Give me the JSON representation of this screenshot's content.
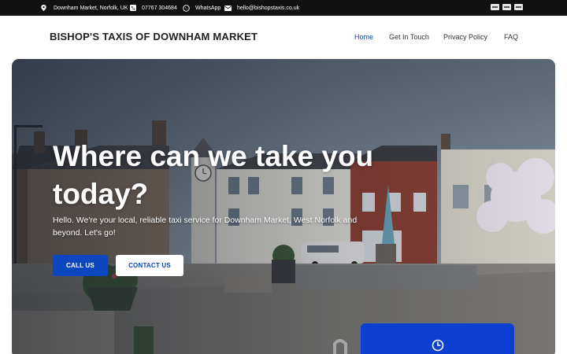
{
  "topbar": {
    "location": "Downham Market, Norfolk, UK",
    "phone": "07767 304684",
    "whatsapp": "WhatsApp",
    "email": "hello@bishopstaxis.co.uk",
    "payment_icons": [
      "card-icon",
      "card-icon",
      "card-icon"
    ]
  },
  "header": {
    "brand": "BISHOP'S TAXIS OF DOWNHAM MARKET",
    "nav": [
      {
        "label": "Home",
        "active": true
      },
      {
        "label": "Get In Touch",
        "active": false
      },
      {
        "label": "Privacy Policy",
        "active": false
      },
      {
        "label": "FAQ",
        "active": false
      }
    ]
  },
  "hero": {
    "title": "Where can we take you today?",
    "subtitle": "Hello. We're your local, reliable taxi service for Downham Market, West Norfolk and beyond. Let's go!",
    "call_label": "CALL US",
    "contact_label": "CONTACT US",
    "card_icon": "clock-icon"
  },
  "colors": {
    "accent": "#0d47c0",
    "card": "#0d3fd0",
    "topbar": "#111111"
  }
}
